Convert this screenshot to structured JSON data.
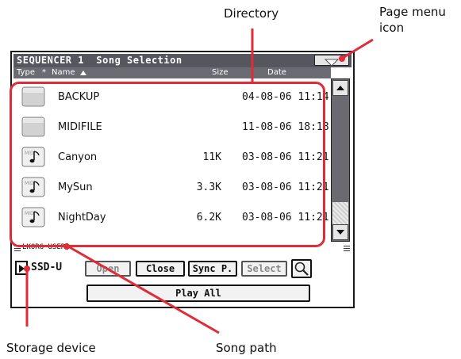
{
  "callouts": {
    "directory": "Directory",
    "page_menu_line1": "Page menu",
    "page_menu_line2": "icon",
    "storage_device": "Storage device",
    "song_path": "Song path"
  },
  "window": {
    "title": "SEQUENCER 1  Song Selection"
  },
  "columns": {
    "type": "Type",
    "sort_indicator": "*",
    "name": "Name",
    "size": "Size",
    "date": "Date"
  },
  "files": [
    {
      "icon": "folder-icon",
      "name": "BACKUP",
      "size": "",
      "date": "04-08-06 11:14"
    },
    {
      "icon": "folder-icon",
      "name": "MIDIFILE",
      "size": "",
      "date": "11-08-06 18:18"
    },
    {
      "icon": "song-file-icon",
      "name": "Canyon",
      "size": "11K",
      "date": "03-08-06 11:21"
    },
    {
      "icon": "song-file-icon",
      "name": "MySun",
      "size": "3.3K",
      "date": "03-08-06 11:21"
    },
    {
      "icon": "song-file-icon",
      "name": "NightDay",
      "size": "6.2K",
      "date": "03-08-06 11:21"
    }
  ],
  "path": "LKORG USER]",
  "device": "SSD-U",
  "buttons": {
    "open": "Open",
    "close": "Close",
    "sync": "Sync P.",
    "select": "Select",
    "play_all": "Play All"
  },
  "colors": {
    "highlight": "#e02b38",
    "titlebar": "#56565e",
    "header": "#6b6b73"
  }
}
